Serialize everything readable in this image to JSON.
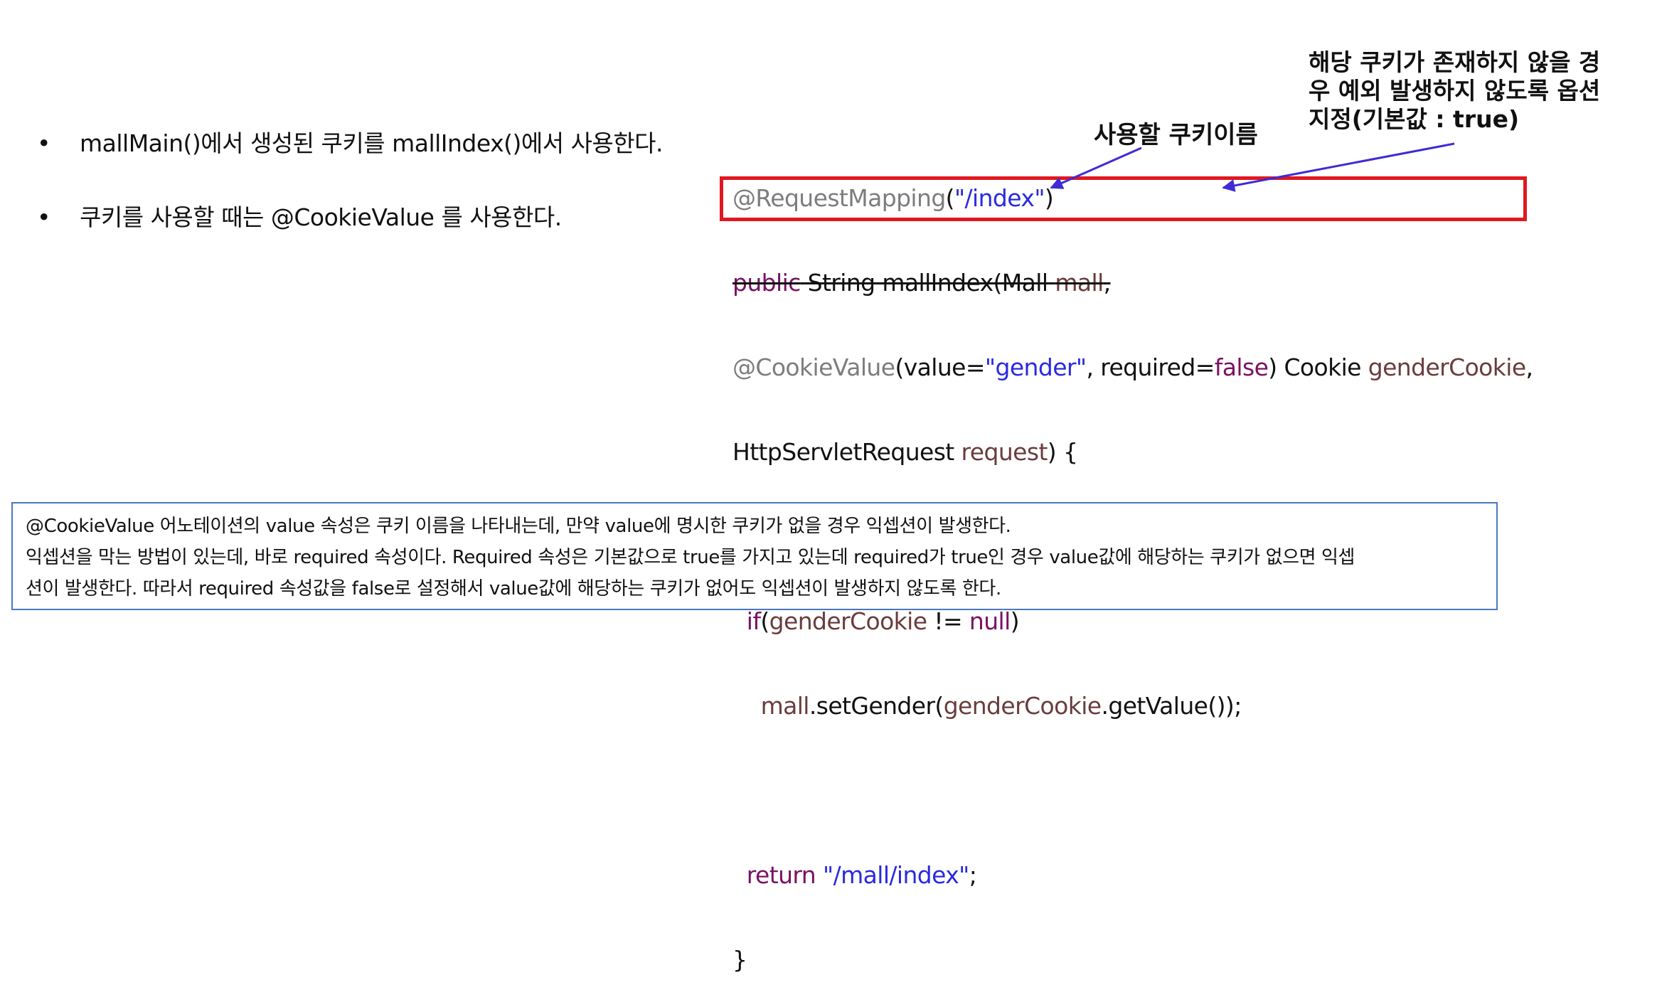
{
  "bullets": [
    "mallMain()에서 생성된 쿠키를 mallIndex()에서 사용한다.",
    "쿠키를 사용할 때는 @CookieValue 를 사용한다."
  ],
  "bullet_glyph": "•",
  "code": {
    "l1": {
      "ann": "@RequestMapping",
      "open": "(",
      "path": "\"/index\"",
      "close": ")"
    },
    "l2": {
      "kw": "public",
      "type": " String mallIndex(Mall ",
      "var": "mall",
      "tail": ","
    },
    "l3": {
      "ann": "@CookieValue",
      "p1": "(value=",
      "value": "\"gender\"",
      "p2": ", required=",
      "falsekw": "false",
      "p3": ") Cookie ",
      "var": "genderCookie",
      "tail": ","
    },
    "l4": {
      "type": "HttpServletRequest ",
      "var": "request",
      "tail": ") {"
    },
    "l6": {
      "kw": "if",
      "open": "(",
      "var": "genderCookie",
      "op": " != ",
      "null": "null",
      "close": ")"
    },
    "l7": {
      "var": "mall",
      "call": ".setGender(",
      "var2": "genderCookie",
      "tail": ".getValue());"
    },
    "l9": {
      "kw": "return",
      "str": "\"/mall/index\"",
      "semi": ";"
    },
    "l10": "}"
  },
  "annotations": {
    "cookie_name": "사용할 쿠키이름",
    "required_note": [
      "해당 쿠키가 존재하지 않을 경",
      "우 예외 발생하지 않도록 옵션",
      "지정(기본값 : true)"
    ]
  },
  "info_box": [
    "@CookieValue 어노테이션의 value 속성은 쿠키 이름을 나타내는데, 만약 value에 명시한 쿠키가 없을 경우 익셉션이 발생한다.",
    "익셉션을 막는 방법이 있는데, 바로 required 속성이다. Required 속성은 기본값으로 true를 가지고 있는데 required가 true인 경우 value값에 해당하는 쿠키가 없으면 익셉",
    "션이 발생한다. 따라서 required 속성값을 false로 설정해서 value값에 해당하는 쿠키가 없어도 익셉션이 발생하지 않도록 한다."
  ],
  "colors": {
    "highlight_box": "#e01820",
    "arrow": "#3f2bd6",
    "info_border": "#4a78c2",
    "string_blue": "#2a2adf",
    "keyword_purple": "#7a1163"
  }
}
